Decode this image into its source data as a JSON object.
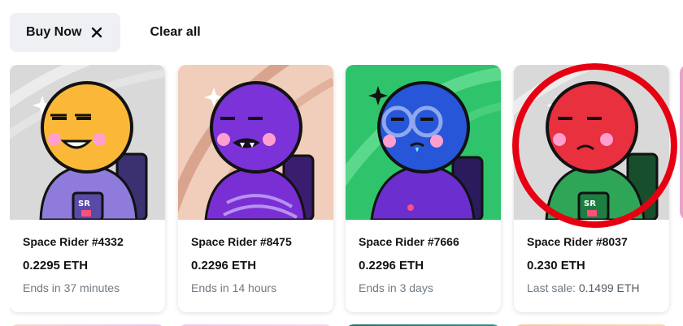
{
  "filters": {
    "active_chip": {
      "label": "Buy Now",
      "icon": "close-icon"
    },
    "clear_all_label": "Clear all"
  },
  "cards": [
    {
      "name": "Space Rider #4332",
      "price": "0.2295 ETH",
      "meta": "Ends in 37 minutes",
      "background": "#d9d9d9",
      "face_color": "#fbb838",
      "suit_color": "#8f7bdc"
    },
    {
      "name": "Space Rider #8475",
      "price": "0.2296 ETH",
      "meta": "Ends in 14 hours",
      "background": "#f1cdbb",
      "face_color": "#7b32d8",
      "suit_color": "#7a2fd4"
    },
    {
      "name": "Space Rider #7666",
      "price": "0.2296 ETH",
      "meta": "Ends in 3 days",
      "background": "#2fc46b",
      "face_color": "#2757d8",
      "suit_color": "#6c2fcf"
    },
    {
      "name": "Space Rider #8037",
      "price": "0.230 ETH",
      "meta_label": "Last sale: ",
      "meta_value": "0.1499 ETH",
      "background": "#d9d9d9",
      "face_color": "#e8303f",
      "suit_color": "#2fa557"
    }
  ],
  "highlight": {
    "color": "#e60012",
    "target": "Space Rider #8037"
  }
}
